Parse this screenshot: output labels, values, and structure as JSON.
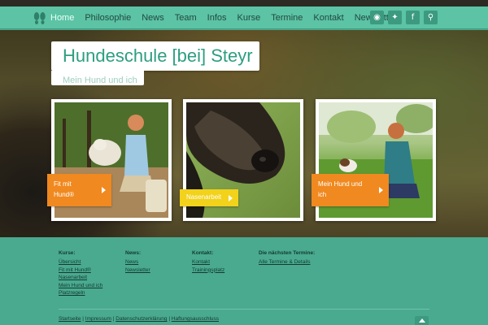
{
  "nav": {
    "items": [
      "Home",
      "Philosophie",
      "News",
      "Team",
      "Infos",
      "Kurse",
      "Termine",
      "Kontakt",
      "Newsletter"
    ],
    "active_index": 0,
    "social_icons": [
      "rss-icon",
      "twitter-icon",
      "facebook-icon",
      "search-icon"
    ],
    "social_glyphs": [
      "◉",
      "✦",
      "f",
      "⚲"
    ]
  },
  "hero": {
    "title": "Hundeschule [bei] Steyr",
    "subtitle": "Mein Hund und ich"
  },
  "cards": [
    {
      "label": "Fit mit Hund®",
      "label_line1": "Fit mit",
      "label_line2": "Hund®"
    },
    {
      "label": "Nasenarbeit"
    },
    {
      "label": "Mein Hund und ich",
      "label_line1": "Mein Hund und",
      "label_line2": "ich"
    }
  ],
  "footer": {
    "col_kurse": {
      "heading": "Kurse:",
      "links": [
        "Übersicht",
        "Fit mit Hund®",
        "Nasenarbeit",
        "Mein Hund und ich",
        "Platzregeln"
      ]
    },
    "col_news": {
      "heading": "News:",
      "links": [
        "News",
        "Newsletter"
      ]
    },
    "col_kontakt": {
      "heading": "Kontakt:",
      "links": [
        "Kontakt",
        "Trainingsplatz"
      ]
    },
    "col_termine": {
      "heading": "Die nächsten Termine:",
      "links": [
        "Alle Termine & Details"
      ]
    },
    "bottom_links": [
      "Startseite",
      "Impressum",
      "Datenschutzerklärung",
      "Haftungsausschluss"
    ],
    "separator": "|"
  },
  "colors": {
    "teal": "#5cc3a4",
    "teal_dark": "#4aaa8f",
    "orange": "#f0891f",
    "yellow": "#f2d21a"
  }
}
